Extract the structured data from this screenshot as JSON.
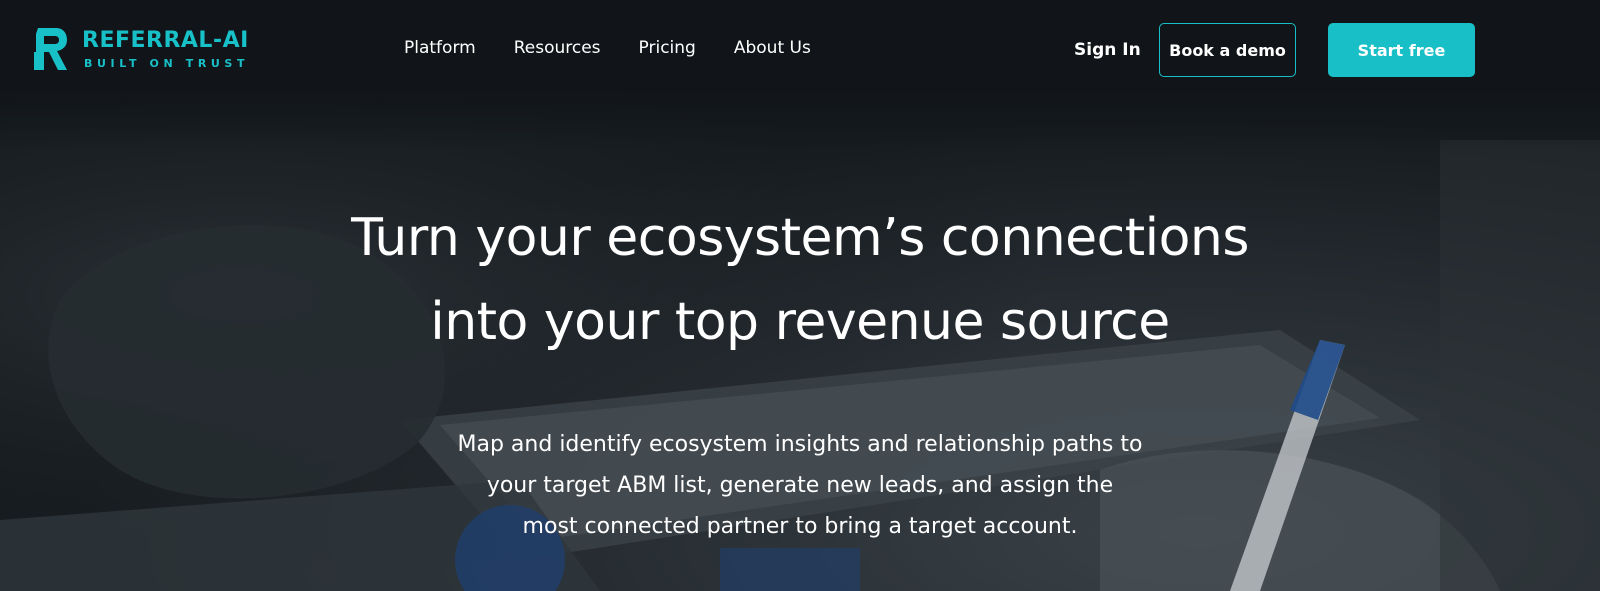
{
  "header": {
    "logo": {
      "name": "REFERRAL-AI",
      "tagline": "BUILT ON TRUST"
    },
    "nav": [
      {
        "label": "Platform"
      },
      {
        "label": "Resources"
      },
      {
        "label": "Pricing"
      },
      {
        "label": "About Us"
      }
    ],
    "sign_in_label": "Sign In",
    "book_demo_label": "Book a demo",
    "start_free_label": "Start free"
  },
  "hero": {
    "title_line1": "Turn your ecosystem’s connections",
    "title_line2": "into your top revenue source",
    "subtitle_line1": "Map and identify ecosystem insights and relationship paths to",
    "subtitle_line2": "your target ABM list, generate new leads, and assign the",
    "subtitle_line3": "most connected partner to bring a target account."
  },
  "colors": {
    "accent": "#19bfc6",
    "background": "#111519",
    "text": "#ffffff"
  },
  "icons": {
    "logo_mark": "logo-r-icon"
  }
}
